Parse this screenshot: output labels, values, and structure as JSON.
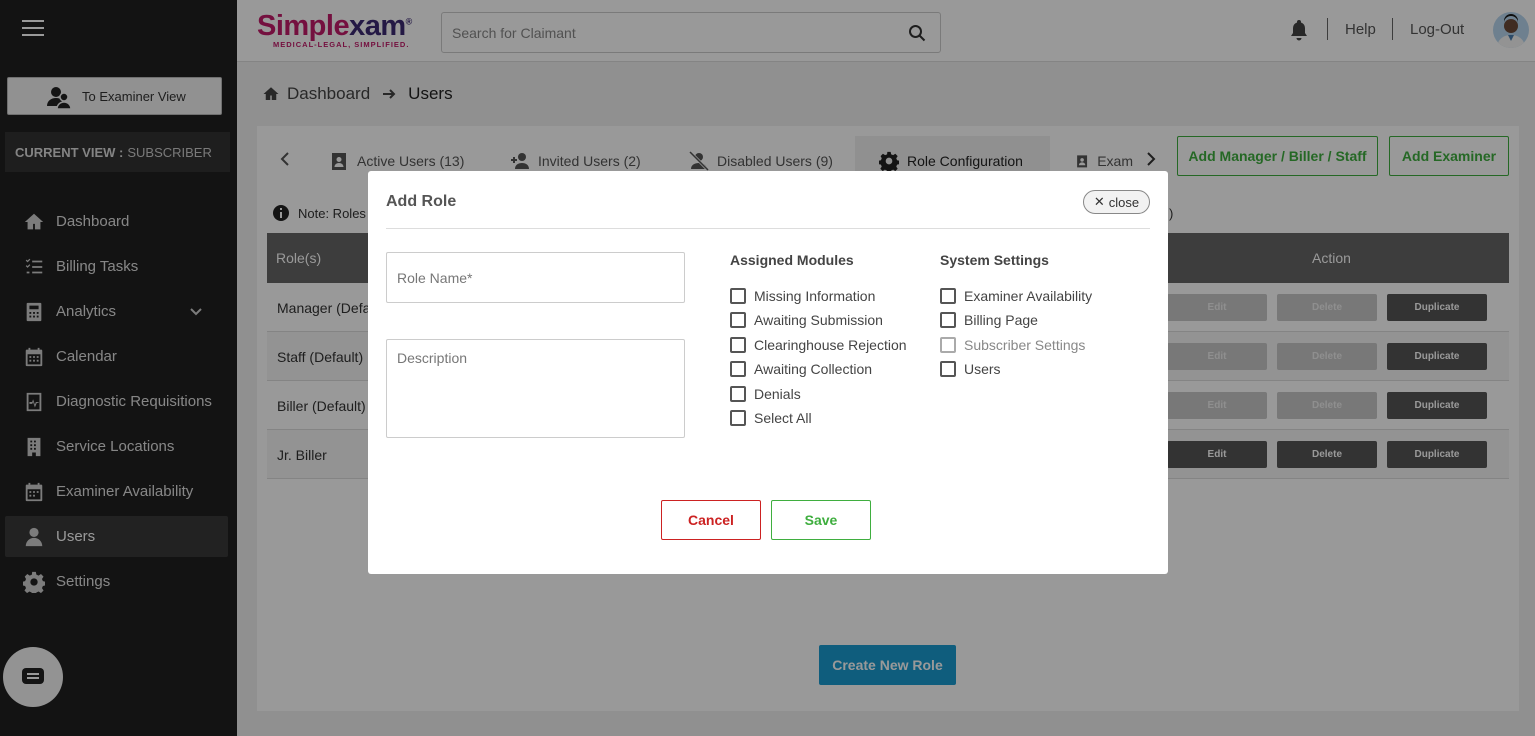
{
  "header": {
    "logo_main": "Simplexam",
    "logo_main_s": "Simple",
    "logo_main_x": "xam",
    "logo_reg": "®",
    "logo_tagline": "MEDICAL-LEGAL, SIMPLIFIED.",
    "search_placeholder": "Search for Claimant",
    "help": "Help",
    "logout": "Log-Out"
  },
  "sidebar": {
    "examiner_view_label": "To Examiner View",
    "current_view_label": "CURRENT VIEW :",
    "current_view_value": "SUBSCRIBER",
    "items": [
      {
        "label": "Dashboard",
        "icon": "home-icon"
      },
      {
        "label": "Billing Tasks",
        "icon": "tasks-icon"
      },
      {
        "label": "Analytics",
        "icon": "calculator-icon"
      },
      {
        "label": "Calendar",
        "icon": "calendar-icon"
      },
      {
        "label": "Diagnostic Requisitions",
        "icon": "requisition-icon"
      },
      {
        "label": "Service Locations",
        "icon": "building-icon"
      },
      {
        "label": "Examiner Availability",
        "icon": "calendar-check-icon"
      },
      {
        "label": "Users",
        "icon": "user-icon"
      },
      {
        "label": "Settings",
        "icon": "gear-icon"
      }
    ],
    "active_item": "Users"
  },
  "breadcrumb": {
    "root": "Dashboard",
    "current": "Users"
  },
  "tabs": [
    {
      "label": "Active Users (13)"
    },
    {
      "label": "Invited Users (2)"
    },
    {
      "label": "Disabled Users (9)"
    },
    {
      "label": "Role Configuration"
    },
    {
      "label": "Exam"
    }
  ],
  "actions": {
    "add_manager": "Add Manager / Biller / Staff",
    "add_examiner": "Add Examiner"
  },
  "note": {
    "text": "Note: Roles",
    "tail": ")"
  },
  "table": {
    "headers": {
      "role": "Role(s)",
      "action": "Action"
    },
    "rows": [
      {
        "name": "Manager (Defa",
        "edit": "Edit",
        "delete": "Delete",
        "duplicate": "Duplicate"
      },
      {
        "name": "Staff (Default)",
        "edit": "Edit",
        "delete": "Delete",
        "duplicate": "Duplicate"
      },
      {
        "name": "Biller (Default)",
        "edit": "Edit",
        "delete": "Delete",
        "duplicate": "Duplicate"
      },
      {
        "name": "Jr. Biller",
        "edit": "Edit",
        "delete": "Delete",
        "duplicate": "Duplicate"
      }
    ]
  },
  "create_role": "Create New Role",
  "modal": {
    "title": "Add Role",
    "close": "close",
    "role_name_placeholder": "Role Name*",
    "description_placeholder": "Description",
    "assigned_modules_title": "Assigned Modules",
    "assigned_modules": [
      "Missing Information",
      "Awaiting Submission",
      "Clearinghouse Rejection",
      "Awaiting Collection",
      "Denials",
      "Select All"
    ],
    "system_settings_title": "System Settings",
    "system_settings": [
      {
        "label": "Examiner Availability",
        "disabled": false
      },
      {
        "label": "Billing Page",
        "disabled": false
      },
      {
        "label": "Subscriber Settings",
        "disabled": true
      },
      {
        "label": "Users",
        "disabled": false
      }
    ],
    "cancel": "Cancel",
    "save": "Save"
  },
  "colors": {
    "brand_pink": "#c21c6a",
    "brand_purple": "#3d2a74",
    "green": "#3fae3f",
    "blue": "#1a9bd0",
    "red": "#cc2222",
    "sidebar_bg": "#212121"
  }
}
